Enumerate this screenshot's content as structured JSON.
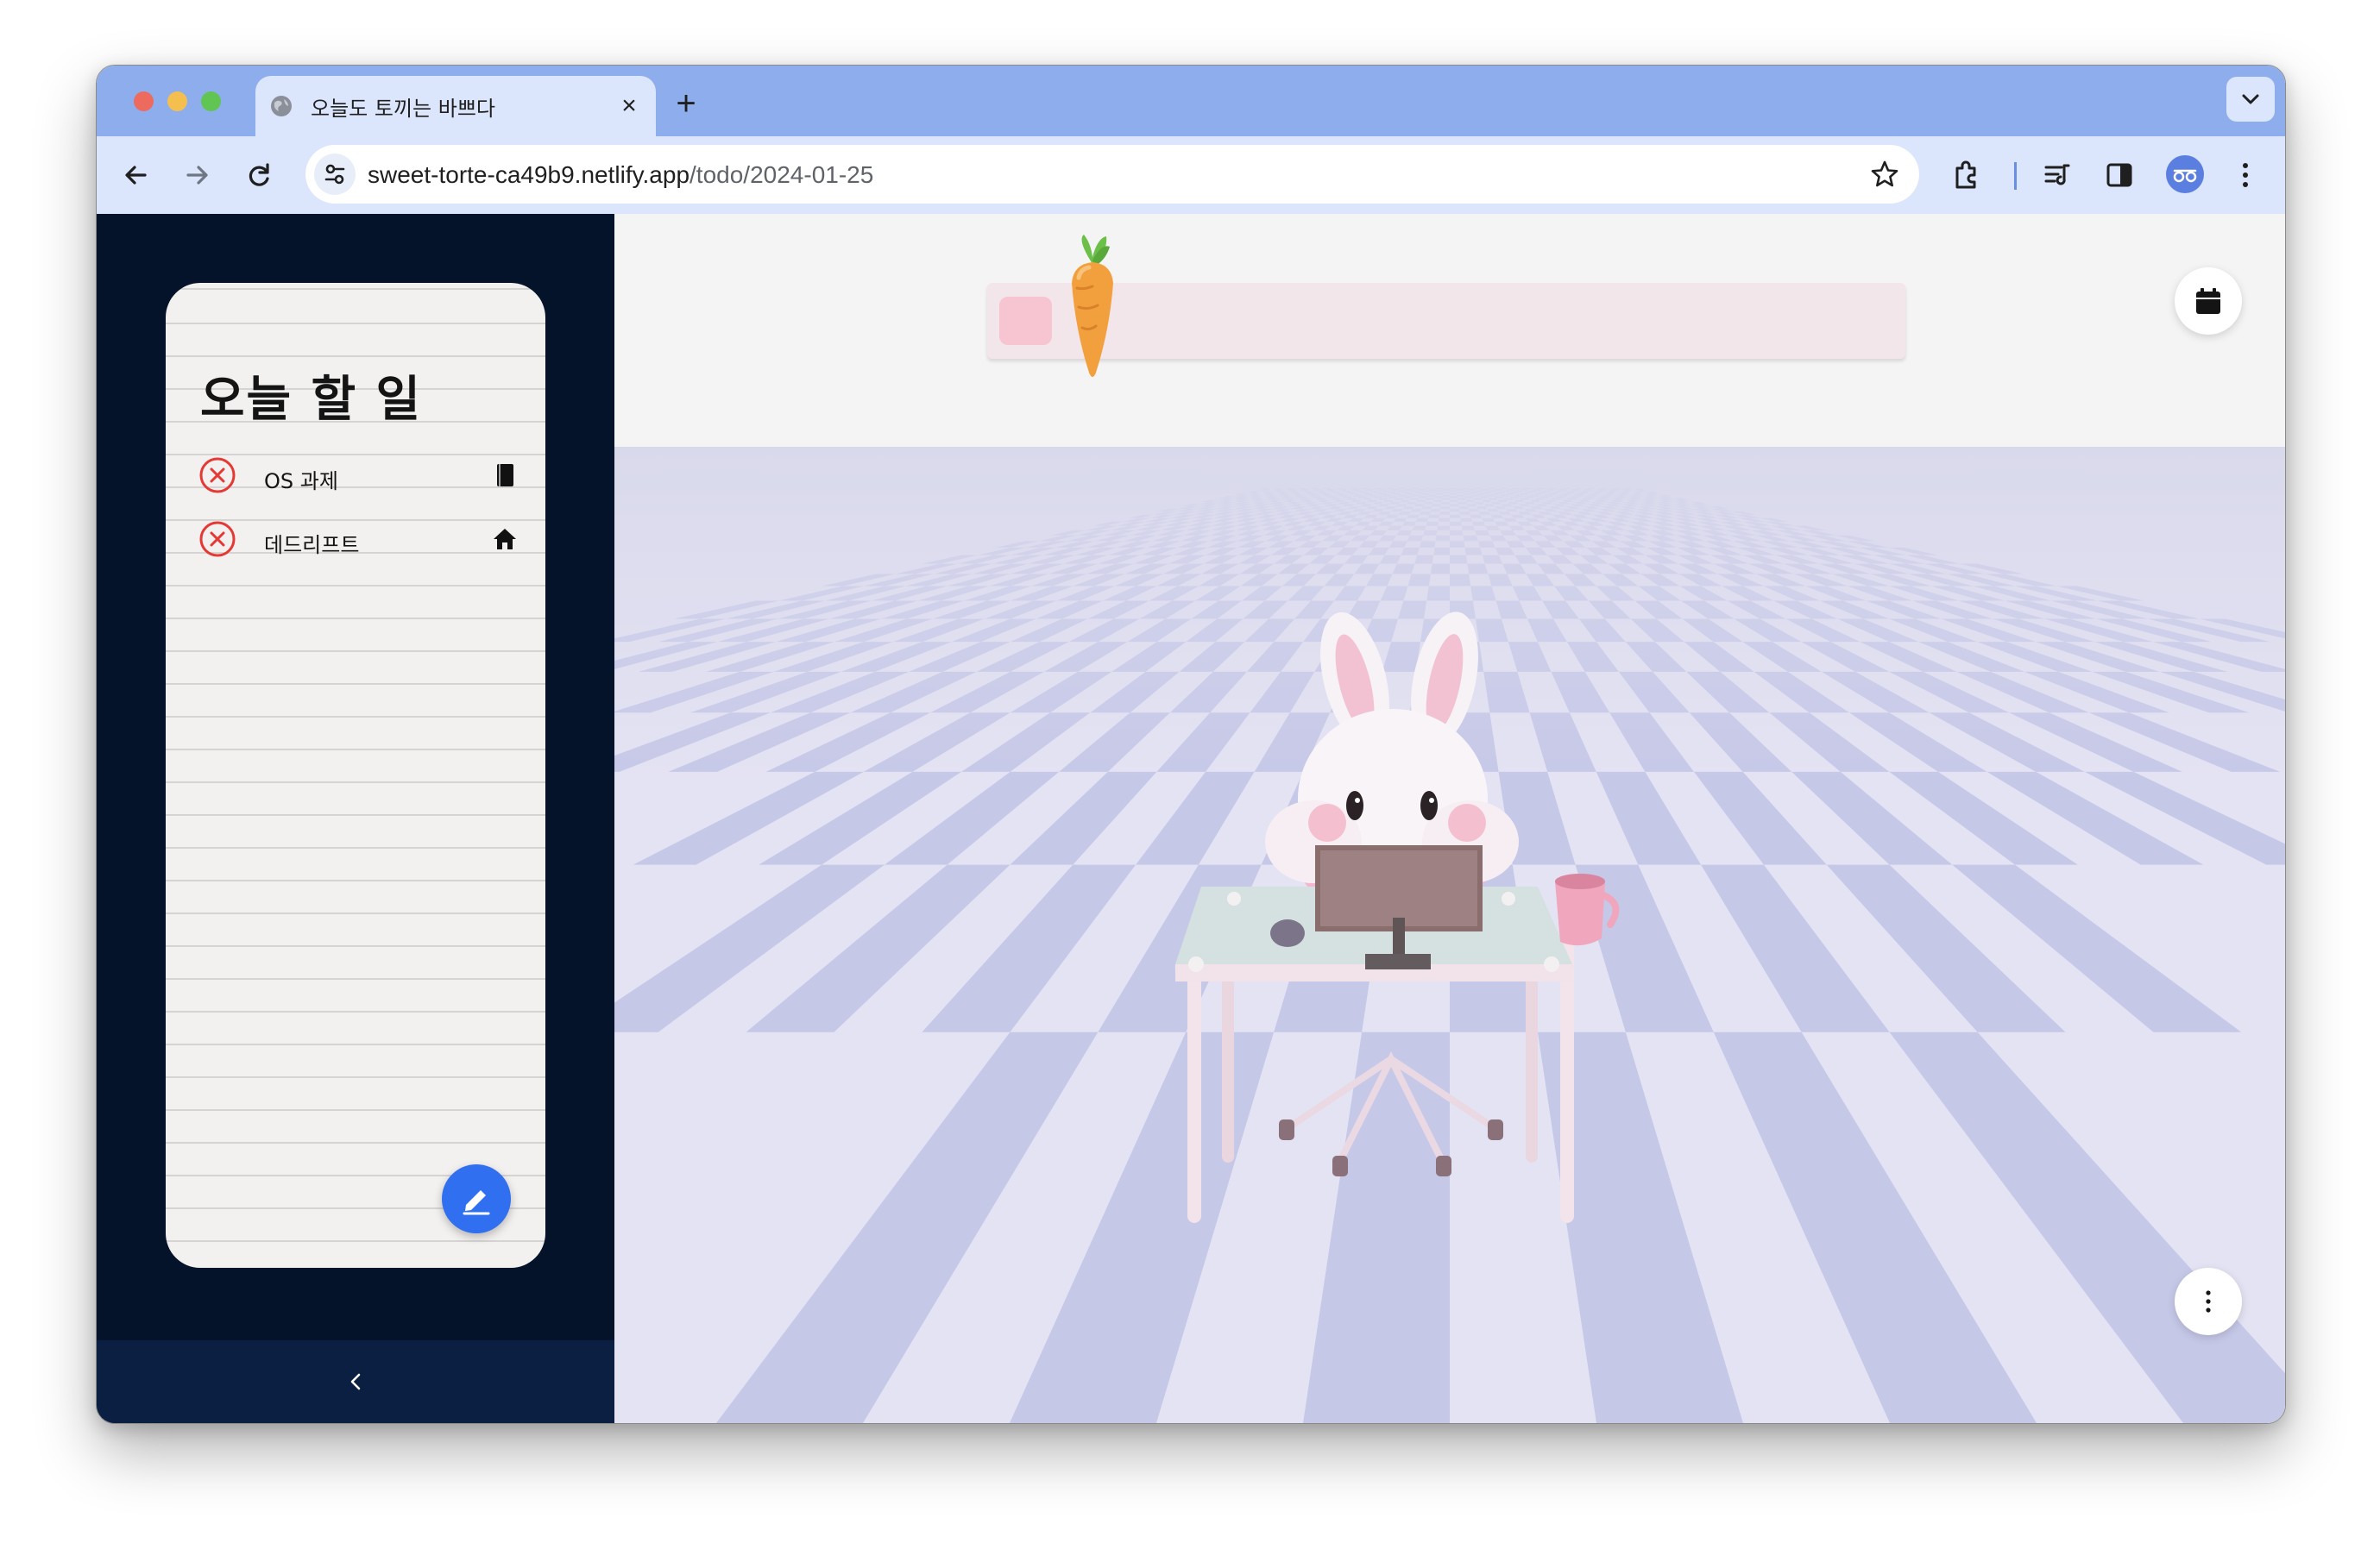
{
  "browser": {
    "tab": {
      "title": "오늘도 토끼는 바쁘다",
      "favicon": "globe-icon",
      "close": "×"
    },
    "new_tab": "+",
    "url": {
      "host": "sweet-torte-ca49b9.netlify.app",
      "path": "/todo/2024-01-25"
    },
    "toolbar_icons": [
      "back-icon",
      "forward-icon",
      "reload-icon",
      "site-info-icon",
      "star-icon",
      "extensions-icon",
      "reading-list-icon",
      "side-panel-icon",
      "profile-avatar",
      "kebab-menu-icon"
    ]
  },
  "sidebar": {
    "title": "오늘 할 일",
    "todos": [
      {
        "label": "OS 과제",
        "status_icon": "x-circle-icon",
        "category_icon": "book-icon"
      },
      {
        "label": "데드리프트",
        "status_icon": "x-circle-icon",
        "category_icon": "home-icon"
      }
    ],
    "edit_button_icon": "pencil-icon",
    "collapse_label": "<"
  },
  "scene": {
    "progress": 0.03,
    "progress_icon": "carrot-icon",
    "calendar_button_icon": "calendar-icon",
    "more_button_icon": "vertical-dots-icon"
  },
  "colors": {
    "tabbar": "#8eadec",
    "toolbar": "#dbe5fb",
    "sidebar": "#05132a",
    "sidebar_footer": "#0b1f42",
    "accent": "#2f6ff0",
    "todo_x": "#e53935",
    "floor_light": "#e4e3f3",
    "floor_dark": "#c6c8e8"
  }
}
